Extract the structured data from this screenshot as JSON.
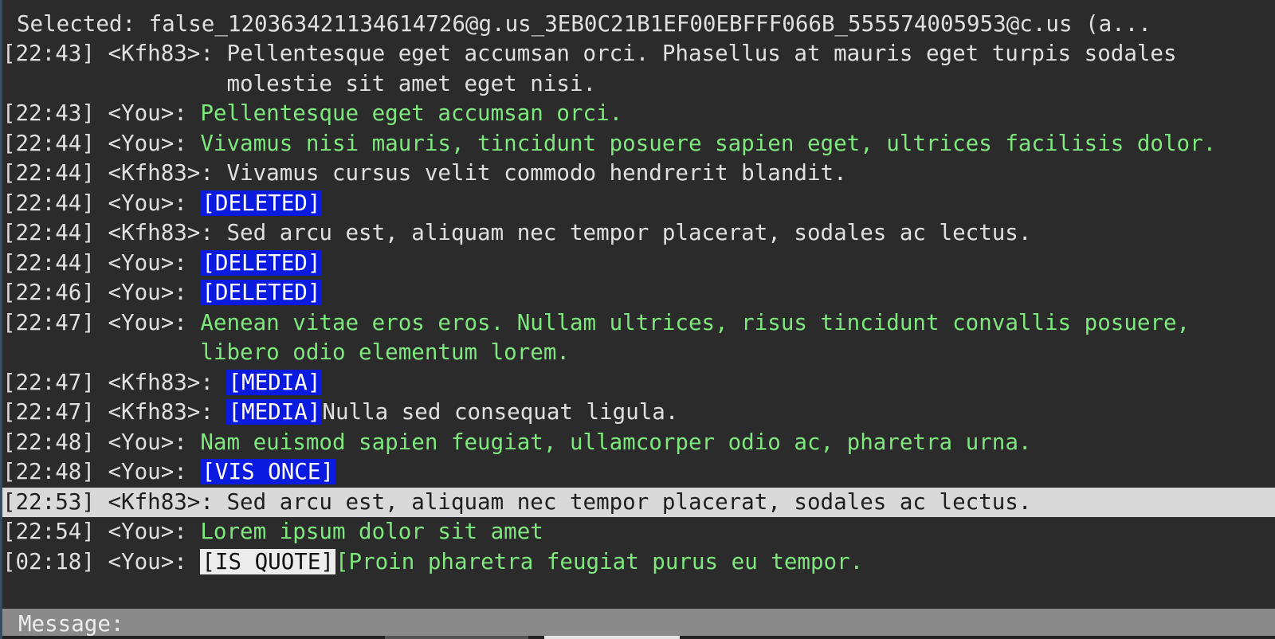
{
  "header": {
    "selected_text": "Selected: false_120363421134614726@g.us_3EB0C21B1EF00EBFFF066B_555574005953@c.us (a..."
  },
  "messages": [
    {
      "time": "[22:43]",
      "sender": "<Kfh83>:",
      "from_me": false,
      "parts": [
        {
          "kind": "text",
          "text": "Pellentesque eget accumsan orci. Phasellus at mauris eget turpis sodales molestie sit amet eget nisi."
        }
      ]
    },
    {
      "time": "[22:43]",
      "sender": "<You>:",
      "from_me": true,
      "parts": [
        {
          "kind": "text",
          "text": "Pellentesque eget accumsan orci."
        }
      ]
    },
    {
      "time": "[22:44]",
      "sender": "<You>:",
      "from_me": true,
      "parts": [
        {
          "kind": "text",
          "text": "Vivamus nisi mauris, tincidunt posuere sapien eget, ultrices facilisis dolor."
        }
      ]
    },
    {
      "time": "[22:44]",
      "sender": "<Kfh83>:",
      "from_me": false,
      "parts": [
        {
          "kind": "text",
          "text": "Vivamus cursus velit commodo hendrerit blandit."
        }
      ]
    },
    {
      "time": "[22:44]",
      "sender": "<You>:",
      "from_me": true,
      "parts": [
        {
          "kind": "tag",
          "text": "[DELETED]"
        }
      ]
    },
    {
      "time": "[22:44]",
      "sender": "<Kfh83>:",
      "from_me": false,
      "parts": [
        {
          "kind": "text",
          "text": "Sed arcu est, aliquam nec tempor placerat, sodales ac lectus."
        }
      ]
    },
    {
      "time": "[22:44]",
      "sender": "<You>:",
      "from_me": true,
      "parts": [
        {
          "kind": "tag",
          "text": "[DELETED]"
        }
      ]
    },
    {
      "time": "[22:46]",
      "sender": "<You>:",
      "from_me": true,
      "parts": [
        {
          "kind": "tag",
          "text": "[DELETED]"
        }
      ]
    },
    {
      "time": "[22:47]",
      "sender": "<You>:",
      "from_me": true,
      "parts": [
        {
          "kind": "text",
          "text": "Aenean vitae eros eros. Nullam ultrices, risus tincidunt convallis posuere, libero odio elementum lorem."
        }
      ]
    },
    {
      "time": "[22:47]",
      "sender": "<Kfh83>:",
      "from_me": false,
      "parts": [
        {
          "kind": "tag",
          "text": "[MEDIA]"
        }
      ]
    },
    {
      "time": "[22:47]",
      "sender": "<Kfh83>:",
      "from_me": false,
      "parts": [
        {
          "kind": "tag",
          "text": "[MEDIA]"
        },
        {
          "kind": "text",
          "text": "Nulla sed consequat ligula."
        }
      ]
    },
    {
      "time": "[22:48]",
      "sender": "<You>:",
      "from_me": true,
      "parts": [
        {
          "kind": "text",
          "text": "Nam euismod sapien feugiat, ullamcorper odio ac, pharetra urna."
        }
      ]
    },
    {
      "time": "[22:48]",
      "sender": "<You>:",
      "from_me": true,
      "parts": [
        {
          "kind": "tag",
          "text": "[VIS ONCE]"
        }
      ]
    },
    {
      "time": "[22:53]",
      "sender": "<Kfh83>:",
      "from_me": false,
      "selected": true,
      "parts": [
        {
          "kind": "text",
          "text": "Sed arcu est, aliquam nec tempor placerat, sodales ac lectus."
        }
      ]
    },
    {
      "time": "[22:54]",
      "sender": "<You>:",
      "from_me": true,
      "parts": [
        {
          "kind": "text",
          "text": "Lorem ipsum dolor sit amet"
        }
      ]
    },
    {
      "time": "[02:18]",
      "sender": "<You>:",
      "from_me": true,
      "parts": [
        {
          "kind": "quote",
          "text": "[IS QUOTE]"
        },
        {
          "kind": "text",
          "text": "[Proin pharetra feugiat purus eu tempor."
        }
      ]
    }
  ],
  "composer": {
    "label": "Message:",
    "value": ""
  },
  "colors": {
    "background": "#2b2b2b",
    "own_message": "#7ee87e",
    "tag_background": "#0a1adf",
    "selected_row": "#d9d9d9",
    "composer_bar": "#8a8a8a"
  }
}
